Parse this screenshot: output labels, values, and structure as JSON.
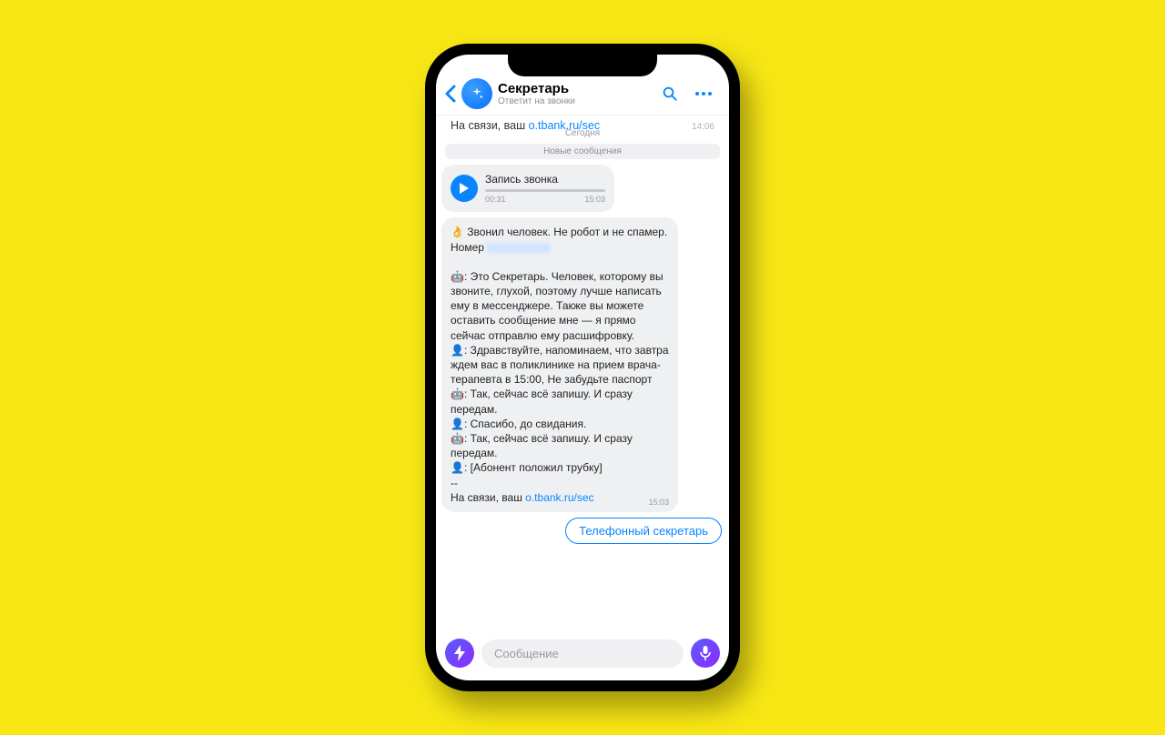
{
  "header": {
    "title": "Секретарь",
    "subtitle": "Ответит на звонки"
  },
  "previous": {
    "text_prefix": "На связи, ваш ",
    "link": "o.tbank.ru/sec",
    "time": "14:06"
  },
  "date_separator": "Сегодня",
  "new_separator": "Новые сообщения",
  "voice": {
    "title": "Запись звонка",
    "duration": "00:31",
    "time": "15:03"
  },
  "transcript": {
    "line1": "👌 Звонил человек. Не робот и не спамер. Номер ",
    "line2": "🤖: Это Секретарь. Человек, которому вы звоните, глухой, поэтому лучше написать ему в мессенджере. Также вы можете оставить сообщение мне — я прямо сейчас отправлю ему расшифровку.",
    "line3": "👤: Здравствуйте, напоминаем, что завтра ждем вас в поликлинике на прием врача-терапевта в 15:00, Не забудьте паспорт",
    "line4": "🤖: Так, сейчас всё запишу. И сразу передам.",
    "line5": "👤: Спасибо, до свидания.",
    "line6": "🤖: Так, сейчас всё запишу. И сразу передам.",
    "line7": "👤: [Абонент положил трубку]",
    "sep": "--",
    "footer_prefix": "На связи, ваш ",
    "footer_link": "o.tbank.ru/sec",
    "time": "15:03"
  },
  "chip": "Телефонный секретарь",
  "input": {
    "placeholder": "Сообщение"
  }
}
